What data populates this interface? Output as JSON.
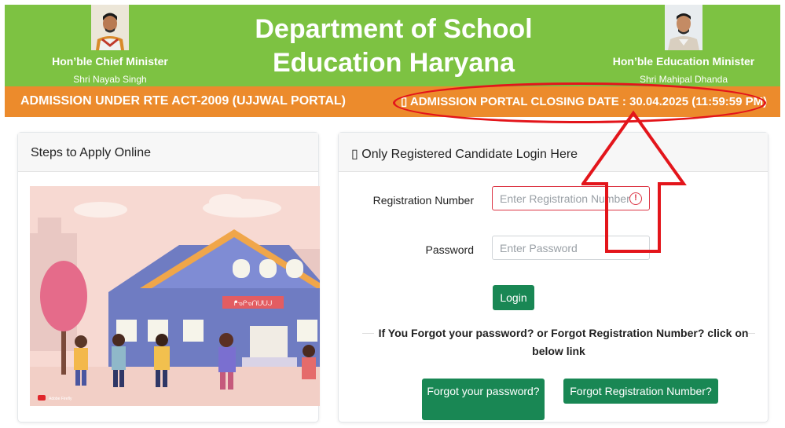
{
  "header": {
    "title": "Department of School Education Haryana",
    "chief_minister": {
      "title": "Hon’ble Chief Minister",
      "name": "Shri Nayab Singh"
    },
    "education_minister": {
      "title": "Hon’ble Education Minister",
      "name": "Shri Mahipal Dhanda"
    }
  },
  "notice_bar": {
    "left_text": "ADMISSION UNDER RTE ACT-2009 (UJJWAL PORTAL)",
    "right_text": "▯ ADMISSION PORTAL CLOSING DATE : 30.04.2025 (11:59:59 PM)"
  },
  "steps_panel": {
    "heading": "Steps to Apply Online",
    "school_sign": "ᖰᓀᑭᓀᑎᑌᑌᒍ",
    "watermark": "Adobe Firefly"
  },
  "login_panel": {
    "heading": "▯ Only Registered Candidate Login Here",
    "registration_label": "Registration Number",
    "registration_placeholder": "Enter Registration Number",
    "error_icon": "!",
    "password_label": "Password",
    "password_placeholder": "Enter Password",
    "login_button": "Login",
    "forgot_text": "If You Forgot your password? or Forgot Registration Number? click on below link",
    "forgot_password_button": "Forgot your password?",
    "forgot_registration_button": "Forgot Registration Number?"
  },
  "colors": {
    "header_green": "#7dc242",
    "orange_bar": "#ec8b2c",
    "annotation_red": "#e3151b",
    "button_green": "#198754"
  }
}
